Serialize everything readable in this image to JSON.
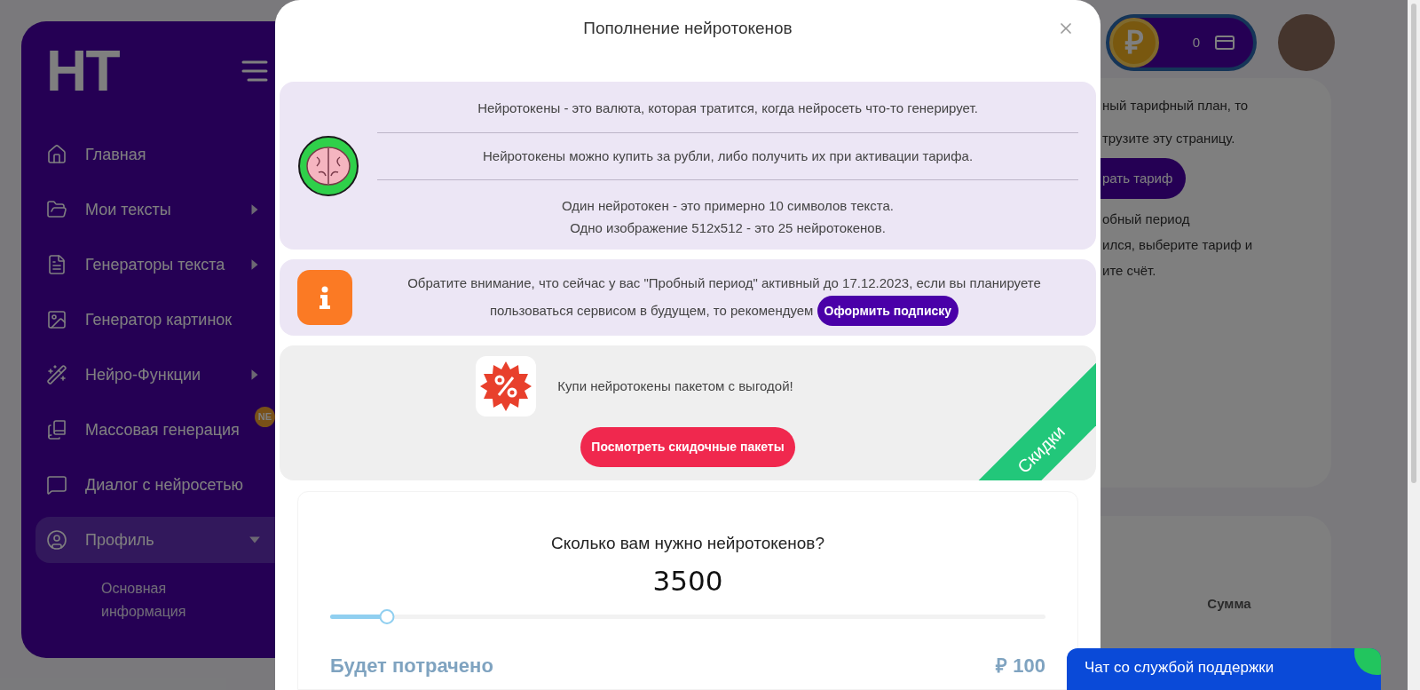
{
  "sidebar": {
    "logo": "НТ",
    "items": [
      {
        "label": "Главная",
        "selected": false
      },
      {
        "label": "Мои тексты",
        "expanded": false,
        "selected": false
      },
      {
        "label": "Генераторы текста",
        "expanded": false,
        "selected": false
      },
      {
        "label": "Генератор картинок",
        "selected": false
      },
      {
        "label": "Нейро-Функции",
        "expanded": false,
        "selected": false
      },
      {
        "label": "Массовая генерация",
        "selected": false,
        "badge": "NE"
      },
      {
        "label": "Диалог с нейросетью",
        "selected": false
      },
      {
        "label": "Профиль",
        "expanded": true,
        "selected": true,
        "children": [
          {
            "label": "Основная информация"
          }
        ]
      }
    ]
  },
  "header": {
    "coin_symbol": "₽",
    "balance": "0"
  },
  "background_card": {
    "lines": [
      "ный тарифный план, то",
      "трузите эту страницу."
    ],
    "button": "рать тариф",
    "lines_after": [
      "обный период",
      "ился, выберите тариф и",
      "ите счёт."
    ],
    "table_column": "Сумма"
  },
  "modal": {
    "title": "Пополнение нейротокенов",
    "info": [
      "Нейротокены - это валюта, которая тратится, когда нейросеть что-то генерирует.",
      "Нейротокены можно купить за рубли, либо получить их при активации тарифа."
    ],
    "info_last": [
      "Один нейротокен - это примерно 10 символов текста.",
      "Одно изображение 512x512 - это 25 нейротокенов."
    ],
    "notice": "Обратите внимание, что сейчас у вас \"Пробный период\" активный до 17.12.2023, если вы планируете пользоваться сервисом в будущем, то рекомендуем",
    "notice_button": "Оформить подписку",
    "promo": {
      "text": "Купи нейротокены пакетом с выгодой!",
      "button": "Посмотреть скидочные пакеты",
      "ribbon": "Скидки"
    },
    "question": "Сколько вам нужно нейротокенов?",
    "amount": "3500",
    "slider": {
      "level": 0.08
    },
    "spent_label": "Будет потрачено",
    "spent_value": "₽ 100"
  },
  "chat_button": "Чат со службой поддержки"
}
